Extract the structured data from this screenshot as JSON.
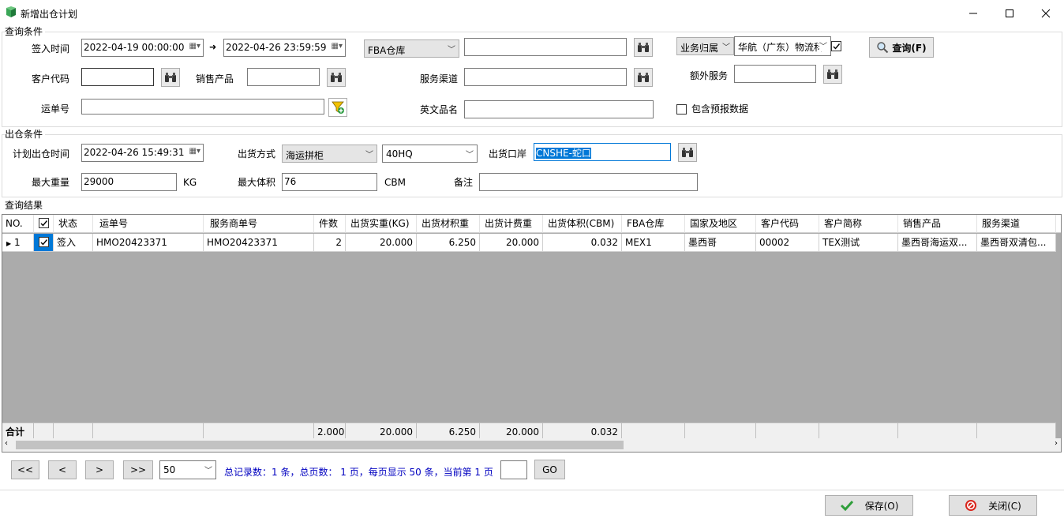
{
  "window": {
    "title": "新增出仓计划",
    "minimize": "—",
    "maximize": "☐",
    "close": "✕"
  },
  "query": {
    "legend": "查询条件",
    "signin_label": "签入时间",
    "signin_from": "2022-04-19 00:00:00",
    "signin_to": "2022-04-26 23:59:59",
    "arrow": "➜",
    "warehouse_type": "FBA仓库",
    "warehouse_value": "",
    "biz_owner_label": "业务归属",
    "biz_owner_value": "华航（广东）物流科",
    "biz_owner_checked": true,
    "search_button": "查询(F)",
    "customer_code_label": "客户代码",
    "customer_code_value": "",
    "sales_product_label": "销售产品",
    "sales_product_value": "",
    "service_channel_label": "服务渠道",
    "service_channel_value": "",
    "extra_service_label": "额外服务",
    "extra_service_value": "",
    "waybill_label": "运单号",
    "waybill_value": "",
    "english_name_label": "英文品名",
    "english_name_value": "",
    "include_prereport_label": "包含预报数据",
    "include_prereport_checked": false
  },
  "outbound": {
    "legend": "出仓条件",
    "plan_time_label": "计划出仓时间",
    "plan_time_value": "2022-04-26 15:49:31",
    "ship_method_label": "出货方式",
    "ship_method_value": "海运拼柜",
    "container_value": "40HQ",
    "port_label": "出货口岸",
    "port_value": "CNSHE-蛇口",
    "max_weight_label": "最大重量",
    "max_weight_value": "29000",
    "weight_unit": "KG",
    "max_volume_label": "最大体积",
    "max_volume_value": "76",
    "volume_unit": "CBM",
    "remark_label": "备注",
    "remark_value": ""
  },
  "results": {
    "legend": "查询结果",
    "columns": [
      "NO.",
      "",
      "状态",
      "运单号",
      "服务商单号",
      "件数",
      "出货实重(KG)",
      "出货材积重",
      "出货计费重",
      "出货体积(CBM)",
      "FBA仓库",
      "国家及地区",
      "客户代码",
      "客户简称",
      "销售产品",
      "服务渠道"
    ],
    "rows": [
      {
        "no": "1",
        "checked": true,
        "status": "签入",
        "waybill": "HMO20423371",
        "provider_no": "HMO20423371",
        "pieces": "2",
        "actual_weight": "20.000",
        "vol_weight": "6.250",
        "charge_weight": "20.000",
        "volume": "0.032",
        "fba": "MEX1",
        "country": "墨西哥",
        "cust_code": "00002",
        "cust_name": "TEX测试",
        "sales_product": "墨西哥海运双...",
        "channel": "墨西哥双清包..."
      }
    ],
    "summary": {
      "label": "合计",
      "pieces": "2.000",
      "actual_weight": "20.000",
      "vol_weight": "6.250",
      "charge_weight": "20.000",
      "volume": "0.032"
    }
  },
  "pager": {
    "first": "<<",
    "prev": "<",
    "next": ">",
    "last": ">>",
    "page_size": "50",
    "info": "总记录数：1 条，总页数：  1 页，每页显示 50 条，当前第 1 页",
    "page_input": "",
    "go": "GO"
  },
  "footer": {
    "save": "保存(O)",
    "close": "关闭(C)"
  },
  "colors": {
    "accent_blue": "#0078d7",
    "grid_bg": "#ababab",
    "pager_text": "#0000c0"
  }
}
